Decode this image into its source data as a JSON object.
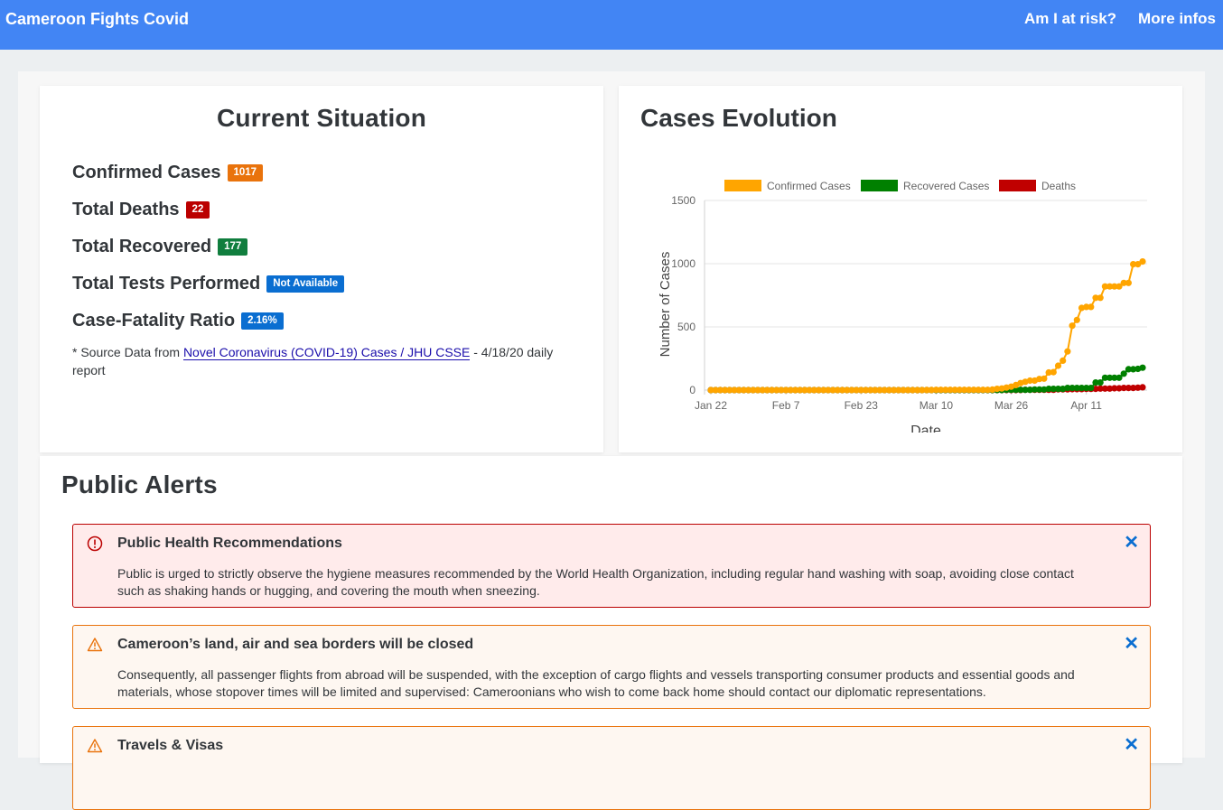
{
  "header": {
    "title": "Cameroon Fights Covid",
    "nav": [
      "Am I at risk?",
      "More infos"
    ]
  },
  "situation": {
    "title": "Current Situation",
    "stats": [
      {
        "label": "Confirmed Cases",
        "value": "1017",
        "color": "#e9730c"
      },
      {
        "label": "Total Deaths",
        "value": "22",
        "color": "#bb0000"
      },
      {
        "label": "Total Recovered",
        "value": "177",
        "color": "#107e3e"
      },
      {
        "label": "Total Tests Performed",
        "value": "Not Available",
        "color": "#0a6ed1"
      },
      {
        "label": "Case-Fatality Ratio",
        "value": "2.16%",
        "color": "#0a6ed1"
      }
    ],
    "source_prefix": "* Source Data from ",
    "source_link": "Novel Coronavirus (COVID-19) Cases / JHU CSSE",
    "source_suffix": " - 4/18/20 daily report"
  },
  "evolution": {
    "title": "Cases Evolution"
  },
  "chart_data": {
    "type": "line",
    "xlabel": "Date",
    "ylabel": "Number of Cases",
    "ylim": [
      0,
      1500
    ],
    "yticks": [
      0,
      500,
      1000,
      1500
    ],
    "xtick_labels": [
      "Jan 22",
      "Feb 7",
      "Feb 23",
      "Mar 10",
      "Mar 26",
      "Apr 11"
    ],
    "legend_position": "top",
    "series": [
      {
        "name": "Confirmed Cases",
        "color": "#ffa500",
        "values": [
          0,
          0,
          0,
          0,
          0,
          0,
          0,
          0,
          0,
          0,
          0,
          0,
          0,
          0,
          0,
          0,
          0,
          0,
          0,
          0,
          0,
          0,
          0,
          0,
          0,
          0,
          0,
          0,
          0,
          0,
          0,
          0,
          0,
          0,
          0,
          0,
          0,
          0,
          0,
          0,
          0,
          0,
          0,
          0,
          0,
          0,
          1,
          1,
          2,
          2,
          2,
          2,
          2,
          2,
          2,
          2,
          2,
          2,
          2,
          2,
          4,
          10,
          13,
          20,
          27,
          40,
          56,
          66,
          75,
          75,
          88,
          91,
          139,
          142,
          193,
          233,
          306,
          509,
          555,
          650,
          658,
          658,
          730,
          730,
          820,
          820,
          820,
          820,
          848,
          848,
          996,
          996,
          1017
        ]
      },
      {
        "name": "Recovered Cases",
        "color": "#008000",
        "values": [
          0,
          0,
          0,
          0,
          0,
          0,
          0,
          0,
          0,
          0,
          0,
          0,
          0,
          0,
          0,
          0,
          0,
          0,
          0,
          0,
          0,
          0,
          0,
          0,
          0,
          0,
          0,
          0,
          0,
          0,
          0,
          0,
          0,
          0,
          0,
          0,
          0,
          0,
          0,
          0,
          0,
          0,
          0,
          0,
          0,
          0,
          0,
          0,
          0,
          0,
          0,
          0,
          0,
          0,
          0,
          0,
          0,
          0,
          0,
          0,
          0,
          0,
          0,
          2,
          2,
          2,
          2,
          2,
          2,
          5,
          5,
          5,
          10,
          10,
          10,
          10,
          17,
          17,
          17,
          17,
          17,
          17,
          60,
          60,
          98,
          98,
          98,
          98,
          130,
          165,
          165,
          168,
          177
        ]
      },
      {
        "name": "Deaths",
        "color": "#c00000",
        "values": [
          0,
          0,
          0,
          0,
          0,
          0,
          0,
          0,
          0,
          0,
          0,
          0,
          0,
          0,
          0,
          0,
          0,
          0,
          0,
          0,
          0,
          0,
          0,
          0,
          0,
          0,
          0,
          0,
          0,
          0,
          0,
          0,
          0,
          0,
          0,
          0,
          0,
          0,
          0,
          0,
          0,
          0,
          0,
          0,
          0,
          0,
          0,
          0,
          0,
          0,
          0,
          0,
          0,
          0,
          0,
          0,
          0,
          0,
          0,
          0,
          0,
          0,
          0,
          0,
          0,
          0,
          1,
          2,
          2,
          2,
          2,
          2,
          2,
          2,
          6,
          6,
          6,
          7,
          7,
          8,
          9,
          9,
          10,
          12,
          12,
          12,
          14,
          14,
          17,
          17,
          17,
          19,
          22
        ]
      }
    ]
  },
  "alerts": {
    "title": "Public Alerts",
    "items": [
      {
        "title": "Public Health Recommendations",
        "body": "Public is urged to strictly observe the hygiene measures recommended by the World Health Organization, including regular hand washing with soap, avoiding close contact such as shaking hands or hugging, and covering the mouth when sneezing.",
        "type": "error",
        "border": "#bb0000",
        "bg": "#ffebeb",
        "icon": "exclamation-circle-icon"
      },
      {
        "title": "Cameroon’s land, air and sea borders will be closed",
        "body": "Consequently, all passenger flights from abroad will be suspended, with the exception of cargo flights and vessels transporting consumer products and essential goods and materials, whose stopover times will be limited and supervised: Cameroonians who wish to come back home should contact our diplomatic representations.",
        "type": "warning",
        "border": "#e9730c",
        "bg": "#fef7f1",
        "icon": "warning-triangle-icon"
      },
      {
        "title": "Travels & Visas",
        "body": "",
        "type": "warning",
        "border": "#e9730c",
        "bg": "#fef7f1",
        "icon": "warning-triangle-icon"
      }
    ]
  }
}
